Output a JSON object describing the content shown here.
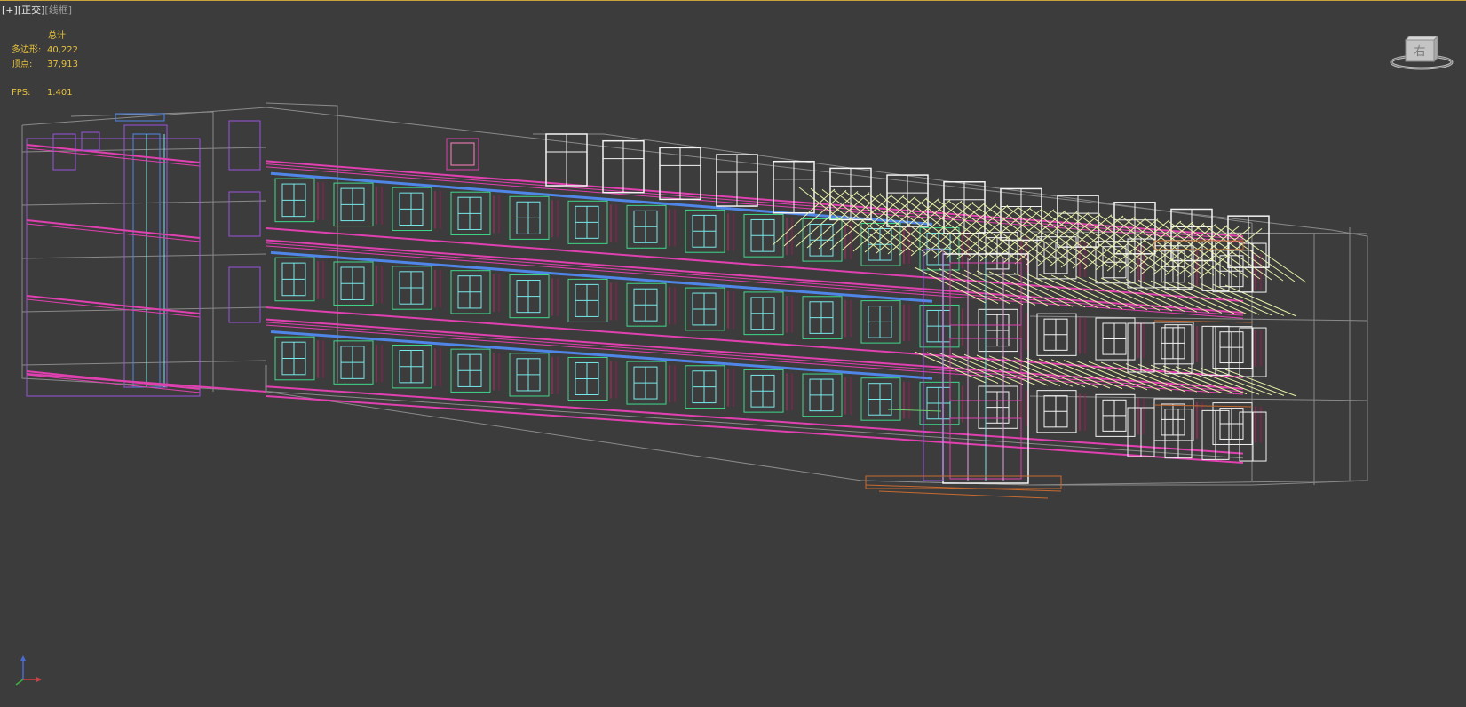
{
  "viewport": {
    "label_parts": [
      "[+]",
      "[正交]",
      "[线框]"
    ],
    "stats": {
      "header": "总计",
      "rows": [
        {
          "key": "多边形:",
          "value": "40,222"
        },
        {
          "key": "顶点:",
          "value": "37,913"
        }
      ],
      "fps_label": "FPS:",
      "fps_value": "1.401"
    },
    "viewcube_label": "右",
    "icons": {
      "viewcube": "viewcube-icon",
      "axis": "axis-tripod-icon"
    },
    "colors": {
      "background": "#3c3c3c",
      "stats_text": "#e6c23c",
      "wire_grey": "#8a8a8a",
      "wire_magenta": "#e040b0",
      "wire_green": "#3fd88a",
      "wire_cyan": "#78e8e8",
      "wire_purple": "#9a55e0",
      "wire_white": "#f4f4f4",
      "wire_yellow": "#e9f0a8",
      "wire_blue": "#4f86e8",
      "wire_orange": "#c86a30"
    }
  }
}
